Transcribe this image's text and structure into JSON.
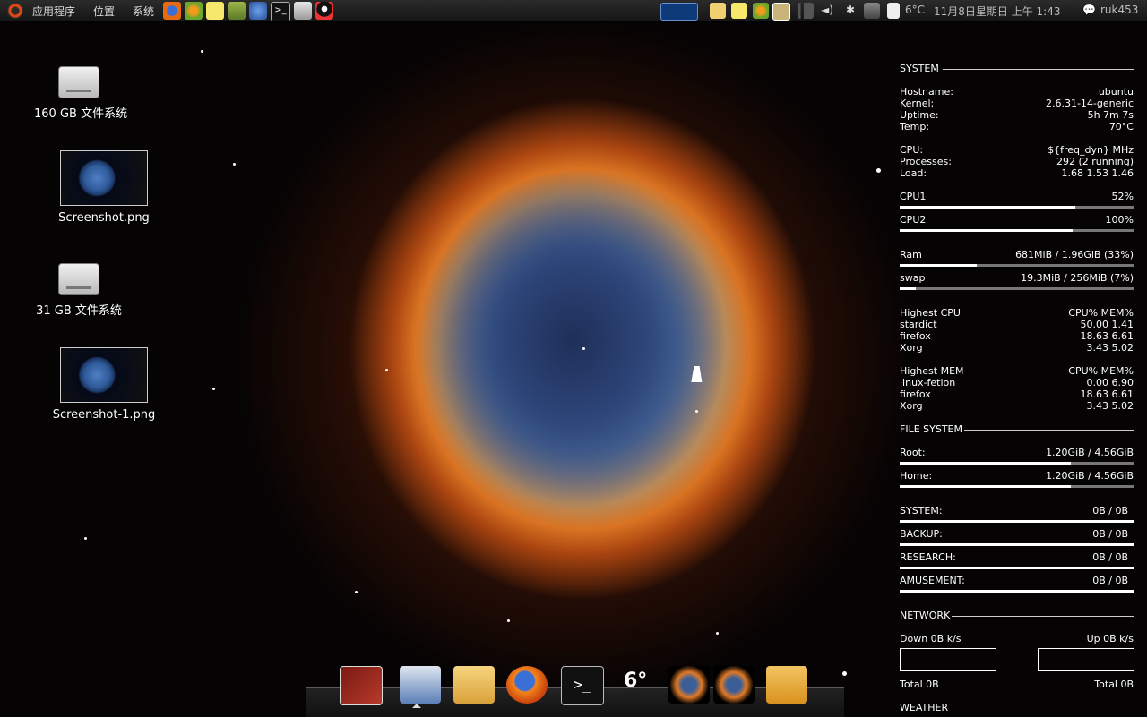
{
  "top_panel": {
    "menus": [
      "应用程序",
      "位置",
      "系统"
    ],
    "clock": "11月8日星期日 上午 1:43",
    "weather": "6°C",
    "user": "ruk453"
  },
  "desktop_icons": [
    {
      "label": "160 GB 文件系统",
      "kind": "drive-icon"
    },
    {
      "label": "Screenshot.png",
      "kind": "image-thumbnail"
    },
    {
      "label": "31 GB 文件系统",
      "kind": "drive-icon"
    },
    {
      "label": "Screenshot-1.png",
      "kind": "image-thumbnail"
    }
  ],
  "conky": {
    "system_title": "SYSTEM",
    "hostname": {
      "k": "Hostname:",
      "v": "ubuntu"
    },
    "kernel": {
      "k": "Kernel:",
      "v": "2.6.31-14-generic"
    },
    "uptime": {
      "k": "Uptime:",
      "v": "5h 7m 7s"
    },
    "temp": {
      "k": "Temp:",
      "v": "70°C"
    },
    "cpu": {
      "k": "CPU:",
      "v": "${freq_dyn} MHz"
    },
    "processes": {
      "k": "Processes:",
      "v": "292 (2 running)"
    },
    "load": {
      "k": "Load:",
      "v": "1.68 1.53 1.46"
    },
    "cpu1": {
      "k": "CPU1",
      "v": "52%",
      "level": 0.75
    },
    "cpu2": {
      "k": "CPU2",
      "v": "100%",
      "level": 0.74
    },
    "ram": {
      "k": "Ram",
      "v": "681MiB / 1.96GiB (33%)",
      "level": 0.33
    },
    "swap": {
      "k": "swap",
      "v": "19.3MiB / 256MiB (7%)",
      "level": 0.07
    },
    "highest_cpu": {
      "k": "Highest CPU",
      "v": "CPU% MEM%",
      "rows": [
        {
          "name": "stardict",
          "val": "50.00  1.41"
        },
        {
          "name": "firefox",
          "val": "18.63  6.61"
        },
        {
          "name": "Xorg",
          "val": "3.43  5.02"
        }
      ]
    },
    "highest_mem": {
      "k": "Highest MEM",
      "v": "CPU% MEM%",
      "rows": [
        {
          "name": "linux-fetion",
          "val": "0.00  6.90"
        },
        {
          "name": "firefox",
          "val": "18.63  6.61"
        },
        {
          "name": "Xorg",
          "val": "3.43  5.02"
        }
      ]
    },
    "fs_title": "FILE SYSTEM",
    "root": {
      "k": "Root:",
      "v": "1.20GiB / 4.56GiB",
      "level": 0.73
    },
    "home": {
      "k": "Home:",
      "v": "1.20GiB / 4.56GiB",
      "level": 0.73
    },
    "mounts": [
      {
        "k": "SYSTEM:",
        "v": "0B  / 0B"
      },
      {
        "k": "BACKUP:",
        "v": "0B  / 0B"
      },
      {
        "k": "RESEARCH:",
        "v": "0B  / 0B"
      },
      {
        "k": "AMUSEMENT:",
        "v": "0B  / 0B"
      }
    ],
    "network_title": "NETWORK",
    "down": "Down 0B  k/s",
    "up": "Up 0B  k/s",
    "total_down": "Total 0B",
    "total_up": "Total 0B",
    "weather_title": "WEATHER"
  },
  "dock": {
    "weather_badge": "6°"
  },
  "colors": {
    "panel": "#1f1f1f",
    "ubuntu_orange": "#dd4814"
  }
}
